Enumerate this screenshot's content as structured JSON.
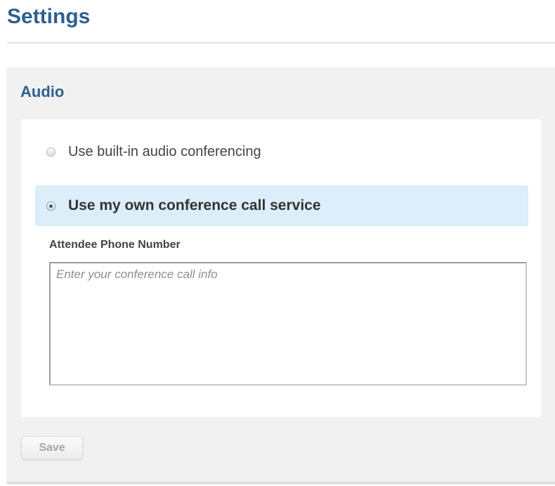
{
  "page": {
    "title": "Settings"
  },
  "audio": {
    "section_title": "Audio",
    "options": [
      {
        "label": "Use built-in audio conferencing",
        "selected": false
      },
      {
        "label": "Use my own conference call service",
        "selected": true
      }
    ],
    "phone": {
      "label": "Attendee Phone Number",
      "placeholder": "Enter your conference call info",
      "value": ""
    }
  },
  "actions": {
    "save_label": "Save"
  },
  "colors": {
    "heading": "#2e5f8f",
    "selected_option_bg": "#dbeef9",
    "panel_bg": "#f1f1f1"
  }
}
